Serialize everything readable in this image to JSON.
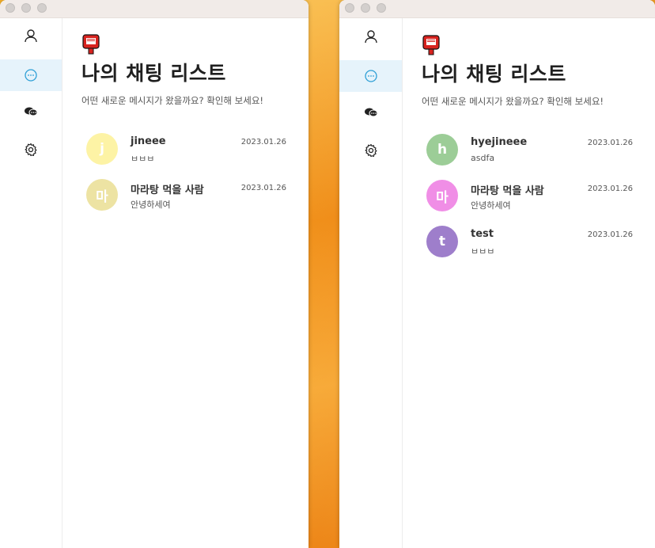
{
  "nav_items": [
    "profile",
    "chats",
    "open-chat",
    "settings"
  ],
  "left_window": {
    "title": "나의 채팅 리스트",
    "subtitle": "어떤 새로운 메시지가 왔을까요? 확인해 보세요!",
    "chats": [
      {
        "avatar": "j",
        "avatar_color": "#fdf3a5",
        "name": "jineee",
        "preview": "ㅂㅂㅂ",
        "date": "2023.01.26"
      },
      {
        "avatar": "마",
        "avatar_color": "#ede3a3",
        "name": "마라탕 먹을 사람",
        "preview": "안녕하세여",
        "date": "2023.01.26"
      }
    ]
  },
  "right_window": {
    "title": "나의 채팅 리스트",
    "subtitle": "어떤 새로운 메시지가 왔을까요? 확인해 보세요!",
    "chats": [
      {
        "avatar": "h",
        "avatar_color": "#9ccd97",
        "name": "hyejineee",
        "preview": "asdfa",
        "date": "2023.01.26"
      },
      {
        "avatar": "마",
        "avatar_color": "#f08ee6",
        "name": "마라탕 먹을 사람",
        "preview": "안녕하세여",
        "date": "2023.01.26"
      },
      {
        "avatar": "t",
        "avatar_color": "#9e7ecb",
        "name": "test",
        "preview": "ㅂㅂㅂ",
        "date": "2023.01.26"
      }
    ]
  },
  "colors": {
    "active_nav_bg": "#e6f3fb",
    "active_icon": "#2e9fd6",
    "logo_red": "#d8231f"
  }
}
